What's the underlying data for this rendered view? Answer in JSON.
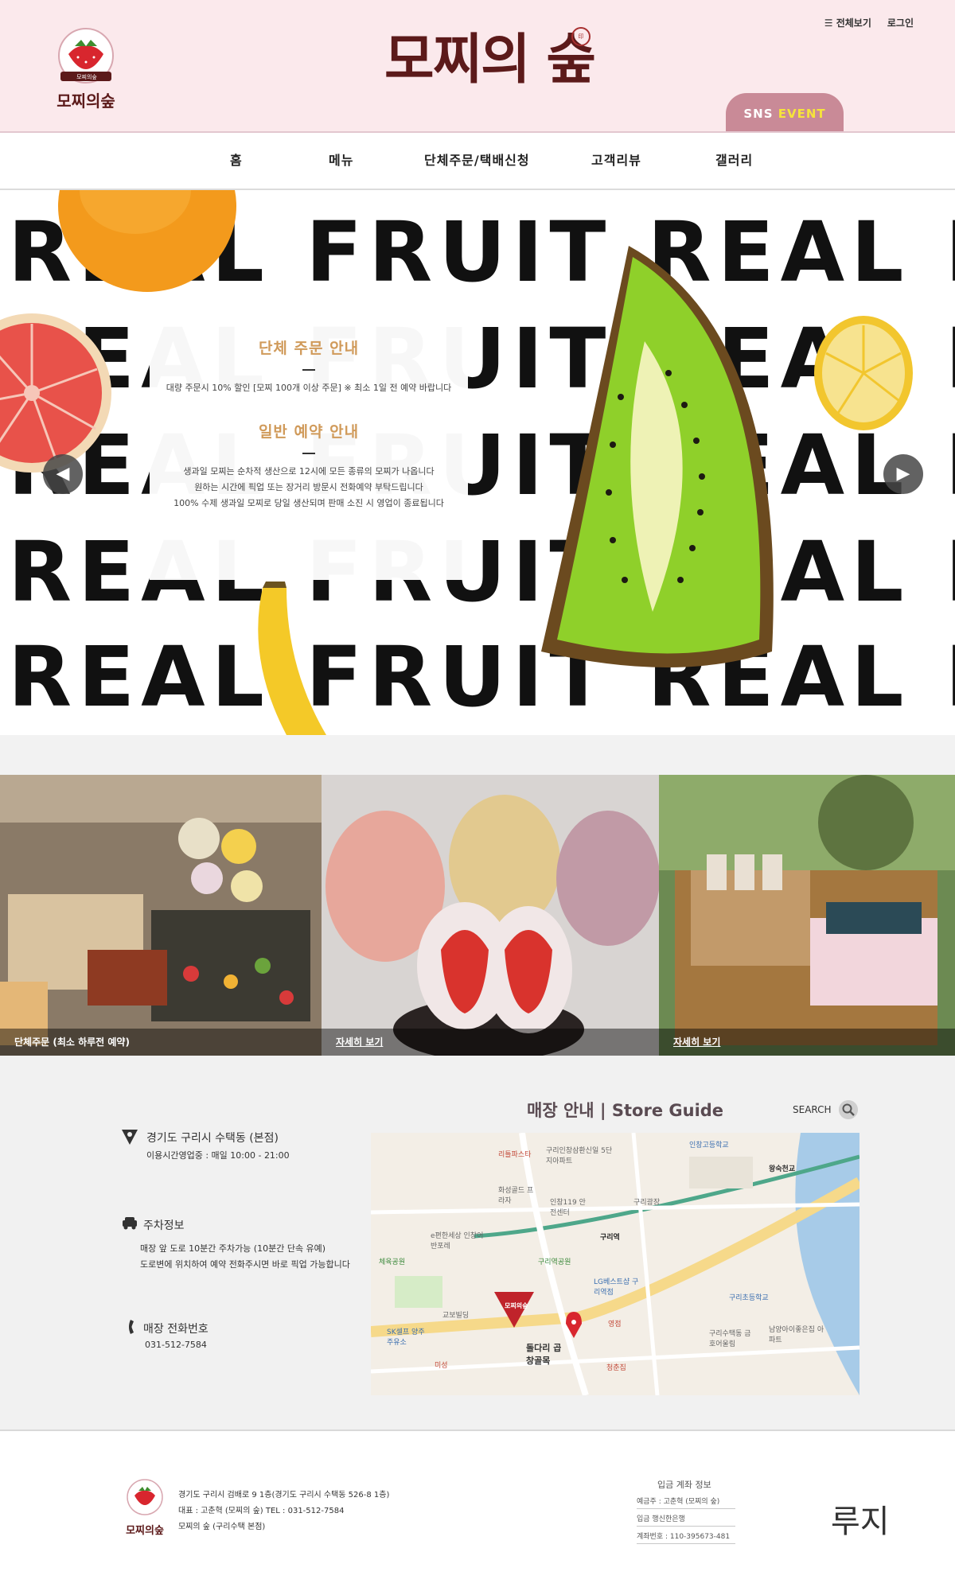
{
  "header": {
    "brand_title": "모찌의 숲",
    "logo_badge_text": "모찌의숲",
    "top_links": {
      "all_view": "☰ 전체보기",
      "login": "로그인"
    },
    "sns_button": {
      "sns": "SNS",
      "event": "EVENT"
    }
  },
  "nav": {
    "items": [
      "홈",
      "메뉴",
      "단체주문/택배신청",
      "고객리뷰",
      "갤러리"
    ]
  },
  "hero": {
    "background_word": "REAL FRUIT REAL FR",
    "group_order": {
      "title": "단체 주문 안내",
      "text": "대량 주문시 10% 할인 [모찌 100개 이상 주문] ※ 최소 1일 전 예약 바랍니다"
    },
    "regular_order": {
      "title": "일반 예약 안내",
      "lines": [
        "생과일 모찌는 순차적 생산으로 12시에 모든 종류의 모찌가 나옵니다",
        "원하는 시간에 픽업 또는 장거리 방문시 전화예약 부탁드립니다",
        "100% 수제 생과일 모찌로 당일 생산되며 판매 소진 시 영업이 종료됩니다"
      ]
    },
    "prev_arrow": "◀",
    "next_arrow": "▶"
  },
  "gallery": {
    "tiles": [
      {
        "caption": "단체주문 (최소 하루전 예약)"
      },
      {
        "caption": "자세히 보기"
      },
      {
        "caption": "자세히 보기"
      }
    ]
  },
  "store": {
    "title": "매장 안내 | Store Guide",
    "search_label": "SEARCH",
    "address": {
      "title": "경기도 구리시 수택동 (본점)",
      "hours": "이용시간영업중 : 매일 10:00 - 21:00"
    },
    "parking": {
      "title": "주차정보",
      "lines": [
        "매장 앞 도로 10분간 주차가능 (10분간 단속 유예)",
        "도로변에 위치하여 예약 전화주시면 바로 픽업 가능합니다"
      ]
    },
    "phone": {
      "title": "매장 전화번호",
      "number": "031-512-7584"
    },
    "map": {
      "marker_label": "모찌의숲",
      "labels": [
        "리틀파스타",
        "구리인창삼환신일 5단지아파트",
        "인창고등학교",
        "왕숙천교",
        "화성골드 프라자",
        "인창119 안전센터",
        "구리광장",
        "e편한세상 인창어반포레",
        "구리역",
        "체육공원",
        "구리역공원",
        "LG베스트샵 구리역점",
        "교보빌딩",
        "구리초등학교",
        "SK셀프 양주주유소",
        "돌다리 곱창골목",
        "영점",
        "구리수택동 금호어울림",
        "남양아이좋은집 아파트",
        "미성",
        "청춘집"
      ]
    }
  },
  "footer": {
    "lines": [
      "경기도 구리시 검배로 9 1층(경기도 구리시 수택동 526-8 1층)",
      "대표 : 고춘혁 (모찌의 숲)    TEL : 031-512-7584",
      "모찌의 숲 (구리수택 본점)"
    ],
    "bank": {
      "title": "입금 계좌 정보",
      "lines": [
        "예금주 : 고춘혁 (모찌의 숲)",
        "입금 행신한은행",
        "계좌번호 : 110-395673-481"
      ]
    },
    "brand_mark": "루지"
  },
  "colors": {
    "header_bg": "#fbe9ec",
    "accent_pink": "#c98a97",
    "brand_dark": "#5c1a1a",
    "card_heading": "#d09a5a"
  }
}
